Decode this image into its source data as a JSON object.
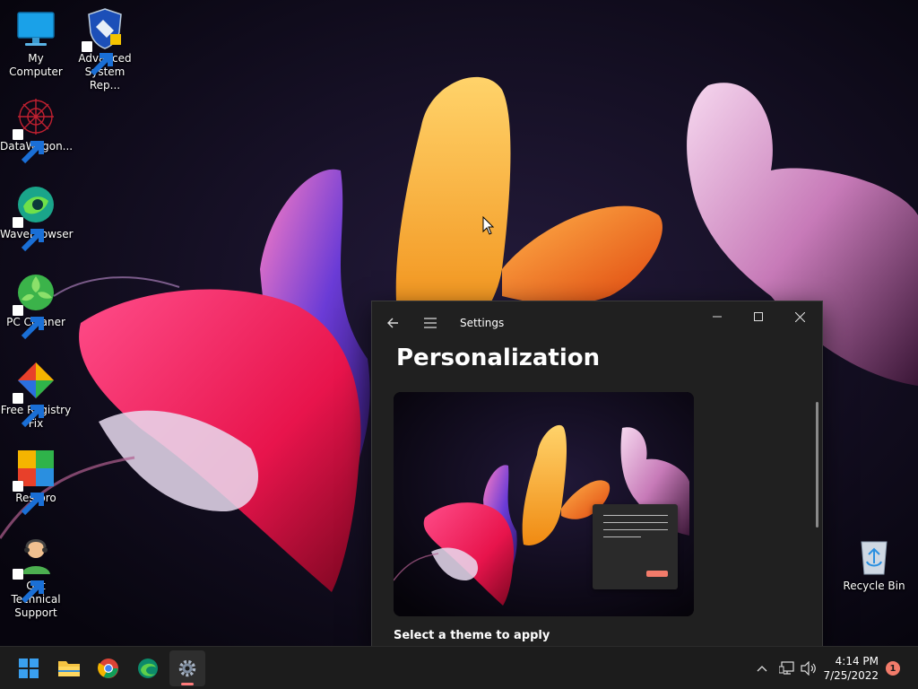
{
  "desktop": {
    "icons": [
      {
        "label": "My Computer"
      },
      {
        "label": "Advanced\nSystem Rep..."
      },
      {
        "label": "DataWagon..."
      },
      {
        "label": "WaveBrowser"
      },
      {
        "label": "PC Cleaner"
      },
      {
        "label": "Free Registry\nFix"
      },
      {
        "label": "Restoro"
      },
      {
        "label": "Get Technical\nSupport"
      },
      {
        "label": "Recycle Bin"
      }
    ]
  },
  "settings_window": {
    "title": "Settings",
    "page_title": "Personalization",
    "section_label": "Select a theme to apply"
  },
  "taskbar": {
    "apps": [
      "start-icon",
      "file-explorer-icon",
      "chrome-icon",
      "edge-icon",
      "settings-icon"
    ],
    "clock": {
      "time": "4:14 PM",
      "date": "7/25/2022"
    },
    "notification_count": "1"
  },
  "colors": {
    "accent": "#ff7b7b",
    "window_bg": "#202020",
    "taskbar_bg": "#1c1c1c",
    "notification_badge": "#f27b6a"
  }
}
